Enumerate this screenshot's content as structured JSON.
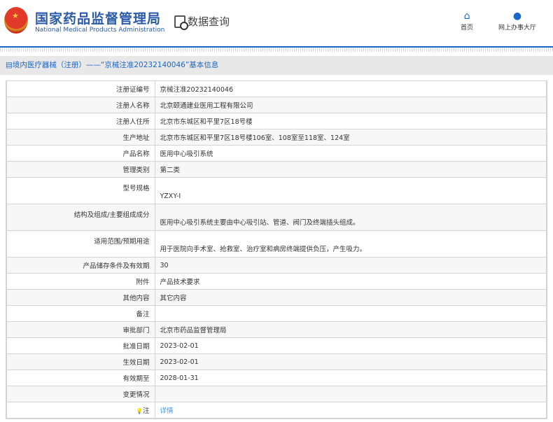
{
  "header": {
    "org_cn": "国家药品监督管理局",
    "org_en": "National Medical Products Administration",
    "section": "数据查询",
    "nav": [
      {
        "label": "首页",
        "icon": "home-icon"
      },
      {
        "label": "网上办事大厅",
        "icon": "user-icon"
      }
    ]
  },
  "title": "境内医疗器械（注册）——“京械注准20232140046”基本信息",
  "rows": [
    {
      "label": "注册证编号",
      "value": "京械注准20232140046"
    },
    {
      "label": "注册人名称",
      "value": "北京颐通建业医用工程有限公司"
    },
    {
      "label": "注册人住所",
      "value": "北京市东城区和平里7区18号楼"
    },
    {
      "label": "生产地址",
      "value": "北京市东城区和平里7区18号楼106室、108室至118室、124室"
    },
    {
      "label": "产品名称",
      "value": "医用中心吸引系统"
    },
    {
      "label": "管理类别",
      "value": "第二类"
    },
    {
      "label": "型号规格",
      "value": "YZXY-Ⅰ"
    },
    {
      "label": "结构及组成/主要组成成分",
      "value": "医用中心吸引系统主要由中心吸引站、管道、阀门及终端插头组成。"
    },
    {
      "label": "适用范围/预期用途",
      "value": "用于医院向手术室、抢救室、治疗室和病房终端提供负压，产生吸力。"
    },
    {
      "label": "产品储存条件及有效期",
      "value": "30"
    },
    {
      "label": "附件",
      "value": "产品技术要求"
    },
    {
      "label": "其他内容",
      "value": "其它内容"
    },
    {
      "label": "备注",
      "value": ""
    },
    {
      "label": "审批部门",
      "value": "北京市药品监督管理局"
    },
    {
      "label": "批准日期",
      "value": "2023-02-01"
    },
    {
      "label": "生效日期",
      "value": "2023-02-01"
    },
    {
      "label": "有效期至",
      "value": "2028-01-31"
    },
    {
      "label": "变更情况",
      "value": ""
    },
    {
      "label": "注",
      "value": "详情"
    }
  ]
}
